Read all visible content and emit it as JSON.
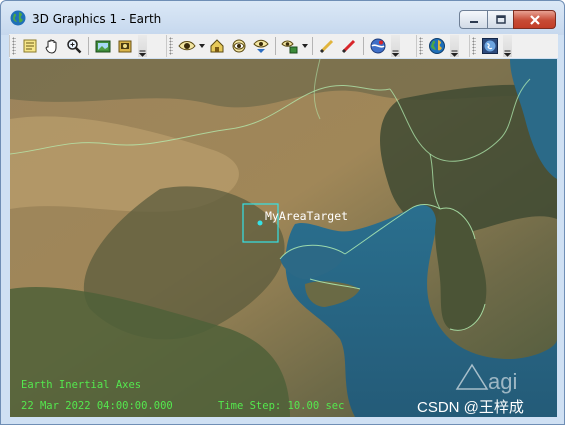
{
  "window": {
    "title": "3D Graphics 1 - Earth",
    "controls": {
      "minimize": "minimize",
      "maximize": "maximize",
      "close": "close"
    }
  },
  "toolbar": {
    "groups": [
      {
        "buttons": [
          "properties-icon",
          "pan-hand-icon",
          "zoom-icon",
          "snapshot-icon",
          "record-icon"
        ]
      },
      {
        "buttons": [
          "view-from-icon",
          "home-view-icon",
          "orbit-view-icon",
          "view-down-icon",
          "object-view-icon",
          "draw-line-icon",
          "measure-icon",
          "globe-manager-icon"
        ]
      },
      {
        "buttons": [
          "earth-icon"
        ]
      },
      {
        "buttons": [
          "map-icon"
        ]
      }
    ]
  },
  "map": {
    "target_label": "MyAreaTarget",
    "colors": {
      "target": "#35e2e6",
      "coastline": "#b7f5b7",
      "ocean": "#2f6d8a",
      "land": "#8a7552"
    }
  },
  "overlay": {
    "frame": "Earth Inertial Axes",
    "date": "22 Mar 2022 04:00:00.000",
    "time_step": "Time Step: 10.00 sec"
  },
  "watermark": {
    "logo_text": "agi",
    "credit": "CSDN @王梓成"
  }
}
